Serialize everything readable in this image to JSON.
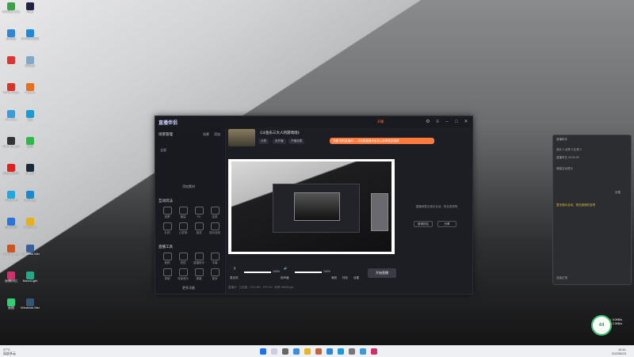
{
  "desktop": {
    "icons": [
      {
        "label": "360安全卫士",
        "color": "#3fa04a"
      },
      {
        "label": "Rest",
        "color": "#224"
      },
      {
        "label": "此电脑",
        "color": "#2e86d8"
      },
      {
        "label": "360软件管家",
        "color": "#1c8ad8"
      },
      {
        "label": "",
        "color": "#d33"
      },
      {
        "label": "回收站",
        "color": "#7fa8c9"
      },
      {
        "label": "WPS Office",
        "color": "#d8352a"
      },
      {
        "label": "Firefox",
        "color": "#e8701a"
      },
      {
        "label": "Chrome",
        "color": "#3a9bd8"
      },
      {
        "label": "QQ",
        "color": "#1a9bd8"
      },
      {
        "label": "OBS Studio",
        "color": "#333"
      },
      {
        "label": "微信",
        "color": "#2eb84b"
      },
      {
        "label": "网易云音乐",
        "color": "#d22"
      },
      {
        "label": "Steam",
        "color": "#1b2838"
      },
      {
        "label": "哔哩哔哩",
        "color": "#20a6e0"
      },
      {
        "label": "腾讯QQ",
        "color": "#1a8ad0"
      },
      {
        "label": "百度网盘",
        "color": "#2d73e0"
      },
      {
        "label": "WeGame",
        "color": "#e6b11a"
      },
      {
        "label": "WPS Office",
        "color": "#c52"
      },
      {
        "label": "Windows Media",
        "color": "#3a5f9a"
      },
      {
        "label": "直播伴侣",
        "color": "#d2306c"
      },
      {
        "label": "MoonLight",
        "color": "#2a8"
      },
      {
        "label": "画图",
        "color": "#3c7"
      },
      {
        "label": "Windows Media Center",
        "color": "#357"
      }
    ]
  },
  "app": {
    "logo": "直播伴侣",
    "titlebar_badge": "开播",
    "source": {
      "title": "《斗鱼乐三大人的游戏场》",
      "chips": [
        "分类",
        "未开播",
        "开播设置"
      ]
    },
    "left": {
      "scene_header": "场景管理",
      "scene_tabs": [
        "场景",
        "添加"
      ],
      "scene_item": "全屏",
      "add_source": "添加素材",
      "interaction_header": "互动玩法",
      "interaction_tools": [
        "投票",
        "福袋",
        "PK",
        "连麦",
        "礼物",
        "心愿单",
        "抽奖",
        "观众连线"
      ],
      "live_tools_header": "直播工具",
      "live_tools": [
        "美颜",
        "滤镜",
        "直播助手",
        "字幕",
        "录制",
        "背景音乐",
        "弹幕",
        "更多"
      ],
      "more": "更多功能"
    },
    "notice": "提醒 您的直播间 — 请完善直播间信息以获得更多推荐",
    "right": {
      "hint": "直播间暂无观众互动，快去邀请吧",
      "buttons": [
        "邀请好友",
        "分享"
      ]
    },
    "controls": {
      "mic_label": "麦克风",
      "mic_value": "100%",
      "speaker_label": "扬声器",
      "speaker_value": "100%",
      "tools": [
        "美颜",
        "特效",
        "设置"
      ],
      "go_live": "开始直播"
    },
    "status": "直播中 · 已连接 · CPU 6% · FPS 30 · 码率 2500Kbps"
  },
  "side_panel": {
    "title": "直播助手",
    "rows": [
      "观众 0   点赞 0   礼物 0",
      "直播时长 00:00:00",
      "弹幕互动提示",
      "设置"
    ],
    "highlight": "暂无观众互动，快去邀请好友吧",
    "footer": "连接正常"
  },
  "network": {
    "speed": "44",
    "up": "↑ 0.0KB/s",
    "down": "↓ 2.3KB/s"
  },
  "taskbar": {
    "weather_temp": "27°C",
    "weather_desc": "局部多云",
    "time": "10:11",
    "date": "2023/5/23"
  }
}
